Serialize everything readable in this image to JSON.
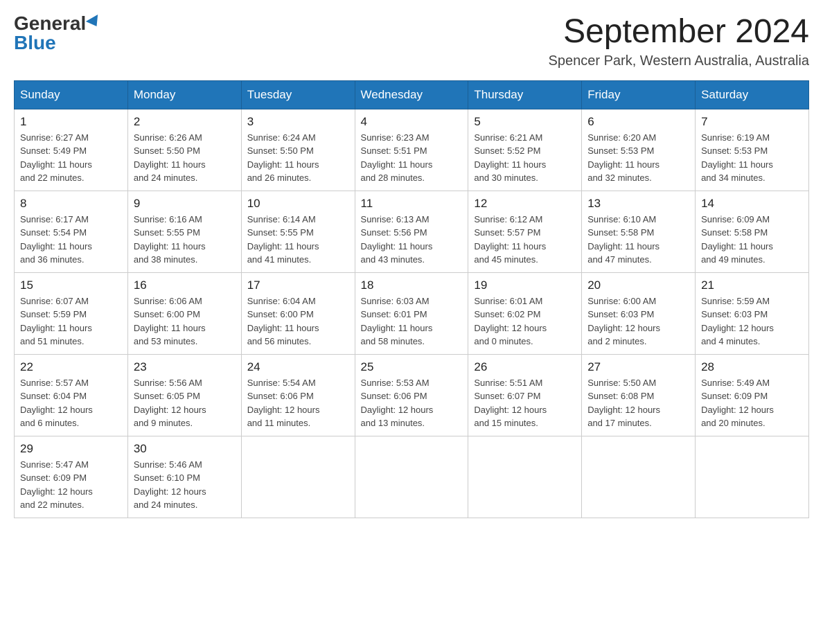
{
  "header": {
    "logo_general": "General",
    "logo_blue": "Blue",
    "month_year": "September 2024",
    "location": "Spencer Park, Western Australia, Australia"
  },
  "days_of_week": [
    "Sunday",
    "Monday",
    "Tuesday",
    "Wednesday",
    "Thursday",
    "Friday",
    "Saturday"
  ],
  "weeks": [
    [
      {
        "day": "1",
        "sunrise": "6:27 AM",
        "sunset": "5:49 PM",
        "daylight": "11 hours and 22 minutes."
      },
      {
        "day": "2",
        "sunrise": "6:26 AM",
        "sunset": "5:50 PM",
        "daylight": "11 hours and 24 minutes."
      },
      {
        "day": "3",
        "sunrise": "6:24 AM",
        "sunset": "5:50 PM",
        "daylight": "11 hours and 26 minutes."
      },
      {
        "day": "4",
        "sunrise": "6:23 AM",
        "sunset": "5:51 PM",
        "daylight": "11 hours and 28 minutes."
      },
      {
        "day": "5",
        "sunrise": "6:21 AM",
        "sunset": "5:52 PM",
        "daylight": "11 hours and 30 minutes."
      },
      {
        "day": "6",
        "sunrise": "6:20 AM",
        "sunset": "5:53 PM",
        "daylight": "11 hours and 32 minutes."
      },
      {
        "day": "7",
        "sunrise": "6:19 AM",
        "sunset": "5:53 PM",
        "daylight": "11 hours and 34 minutes."
      }
    ],
    [
      {
        "day": "8",
        "sunrise": "6:17 AM",
        "sunset": "5:54 PM",
        "daylight": "11 hours and 36 minutes."
      },
      {
        "day": "9",
        "sunrise": "6:16 AM",
        "sunset": "5:55 PM",
        "daylight": "11 hours and 38 minutes."
      },
      {
        "day": "10",
        "sunrise": "6:14 AM",
        "sunset": "5:55 PM",
        "daylight": "11 hours and 41 minutes."
      },
      {
        "day": "11",
        "sunrise": "6:13 AM",
        "sunset": "5:56 PM",
        "daylight": "11 hours and 43 minutes."
      },
      {
        "day": "12",
        "sunrise": "6:12 AM",
        "sunset": "5:57 PM",
        "daylight": "11 hours and 45 minutes."
      },
      {
        "day": "13",
        "sunrise": "6:10 AM",
        "sunset": "5:58 PM",
        "daylight": "11 hours and 47 minutes."
      },
      {
        "day": "14",
        "sunrise": "6:09 AM",
        "sunset": "5:58 PM",
        "daylight": "11 hours and 49 minutes."
      }
    ],
    [
      {
        "day": "15",
        "sunrise": "6:07 AM",
        "sunset": "5:59 PM",
        "daylight": "11 hours and 51 minutes."
      },
      {
        "day": "16",
        "sunrise": "6:06 AM",
        "sunset": "6:00 PM",
        "daylight": "11 hours and 53 minutes."
      },
      {
        "day": "17",
        "sunrise": "6:04 AM",
        "sunset": "6:00 PM",
        "daylight": "11 hours and 56 minutes."
      },
      {
        "day": "18",
        "sunrise": "6:03 AM",
        "sunset": "6:01 PM",
        "daylight": "11 hours and 58 minutes."
      },
      {
        "day": "19",
        "sunrise": "6:01 AM",
        "sunset": "6:02 PM",
        "daylight": "12 hours and 0 minutes."
      },
      {
        "day": "20",
        "sunrise": "6:00 AM",
        "sunset": "6:03 PM",
        "daylight": "12 hours and 2 minutes."
      },
      {
        "day": "21",
        "sunrise": "5:59 AM",
        "sunset": "6:03 PM",
        "daylight": "12 hours and 4 minutes."
      }
    ],
    [
      {
        "day": "22",
        "sunrise": "5:57 AM",
        "sunset": "6:04 PM",
        "daylight": "12 hours and 6 minutes."
      },
      {
        "day": "23",
        "sunrise": "5:56 AM",
        "sunset": "6:05 PM",
        "daylight": "12 hours and 9 minutes."
      },
      {
        "day": "24",
        "sunrise": "5:54 AM",
        "sunset": "6:06 PM",
        "daylight": "12 hours and 11 minutes."
      },
      {
        "day": "25",
        "sunrise": "5:53 AM",
        "sunset": "6:06 PM",
        "daylight": "12 hours and 13 minutes."
      },
      {
        "day": "26",
        "sunrise": "5:51 AM",
        "sunset": "6:07 PM",
        "daylight": "12 hours and 15 minutes."
      },
      {
        "day": "27",
        "sunrise": "5:50 AM",
        "sunset": "6:08 PM",
        "daylight": "12 hours and 17 minutes."
      },
      {
        "day": "28",
        "sunrise": "5:49 AM",
        "sunset": "6:09 PM",
        "daylight": "12 hours and 20 minutes."
      }
    ],
    [
      {
        "day": "29",
        "sunrise": "5:47 AM",
        "sunset": "6:09 PM",
        "daylight": "12 hours and 22 minutes."
      },
      {
        "day": "30",
        "sunrise": "5:46 AM",
        "sunset": "6:10 PM",
        "daylight": "12 hours and 24 minutes."
      },
      null,
      null,
      null,
      null,
      null
    ]
  ],
  "labels": {
    "sunrise": "Sunrise:",
    "sunset": "Sunset:",
    "daylight": "Daylight:"
  }
}
